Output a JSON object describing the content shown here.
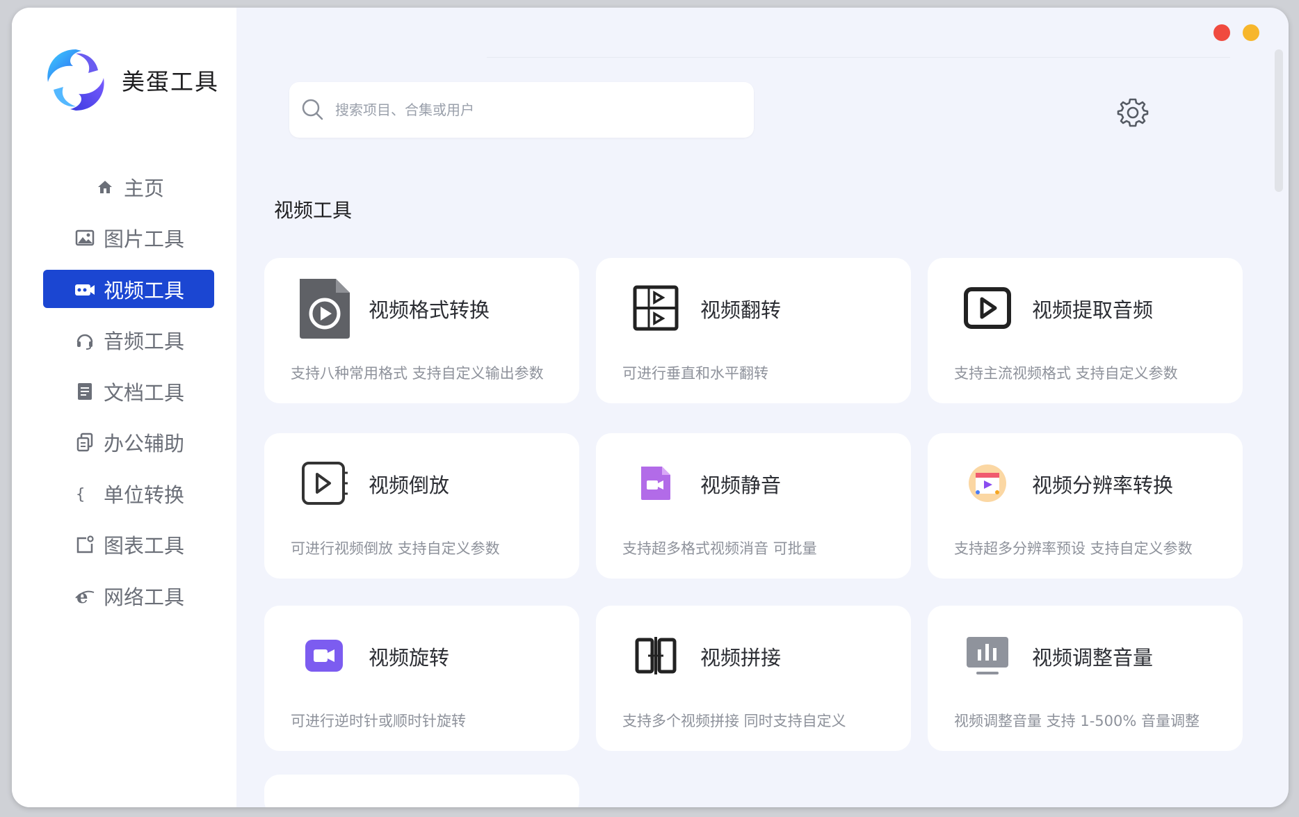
{
  "app": {
    "name": "美蛋工具"
  },
  "window_controls": {
    "close_color": "#f04a3f",
    "minimize_color": "#f7b62b"
  },
  "search": {
    "placeholder": "搜索项目、合集或用户"
  },
  "sidebar": {
    "active_color": "#1b46d2",
    "items": [
      {
        "label": "主页",
        "icon": "home-icon"
      },
      {
        "label": "图片工具",
        "icon": "image-icon"
      },
      {
        "label": "视频工具",
        "icon": "video-camera-icon",
        "active": true
      },
      {
        "label": "音频工具",
        "icon": "headphones-icon"
      },
      {
        "label": "文档工具",
        "icon": "document-icon"
      },
      {
        "label": "办公辅助",
        "icon": "copy-icon"
      },
      {
        "label": "单位转换",
        "icon": "braces-icon"
      },
      {
        "label": "图表工具",
        "icon": "chart-icon"
      },
      {
        "label": "网络工具",
        "icon": "browser-icon"
      }
    ]
  },
  "section": {
    "title": "视频工具"
  },
  "tools": [
    {
      "title": "视频格式转换",
      "desc": "支持八种常用格式 支持自定义输出参数",
      "icon": "video-file-icon"
    },
    {
      "title": "视频翻转",
      "desc": "可进行垂直和水平翻转",
      "icon": "flip-icon"
    },
    {
      "title": "视频提取音频",
      "desc": "支持主流视频格式 支持自定义参数",
      "icon": "play-box-icon"
    },
    {
      "title": "视频倒放",
      "desc": "可进行视频倒放 支持自定义参数",
      "icon": "reverse-play-icon"
    },
    {
      "title": "视频静音",
      "desc": "支持超多格式视频消音 可批量",
      "icon": "purple-video-file-icon"
    },
    {
      "title": "视频分辨率转换",
      "desc": "支持超多分辨率预设 支持自定义参数",
      "icon": "resolution-icon"
    },
    {
      "title": "视频旋转",
      "desc": "可进行逆时针或顺时针旋转",
      "icon": "purple-camera-icon"
    },
    {
      "title": "视频拼接",
      "desc": "支持多个视频拼接 同时支持自定义",
      "icon": "splice-icon"
    },
    {
      "title": "视频调整音量",
      "desc": "视频调整音量 支持 1-500% 音量调整",
      "icon": "volume-bars-icon"
    }
  ]
}
